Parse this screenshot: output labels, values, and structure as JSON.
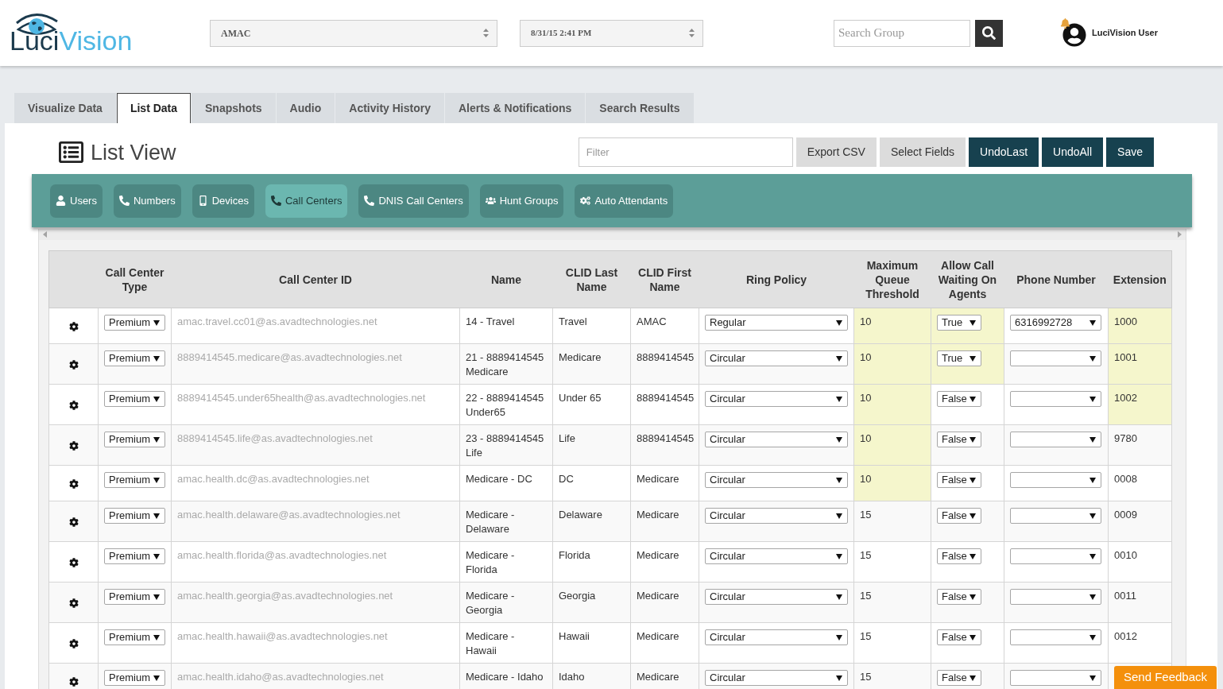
{
  "header": {
    "logo": {
      "dark_part": "Luci",
      "light_part": "Vision"
    },
    "group_select": {
      "value": "AMAC"
    },
    "date_select": {
      "value": "8/31/15 2:41 PM"
    },
    "search": {
      "placeholder": "Search Group"
    },
    "user_name": "LuciVision User"
  },
  "tabs": [
    {
      "label": "Visualize Data",
      "selected": false
    },
    {
      "label": "List Data",
      "selected": true
    },
    {
      "label": "Snapshots",
      "selected": false
    },
    {
      "label": "Audio",
      "selected": false
    },
    {
      "label": "Activity History",
      "selected": false
    },
    {
      "label": "Alerts & Notifications",
      "selected": false
    },
    {
      "label": "Search Results",
      "selected": false
    }
  ],
  "list_view": {
    "title": "List View",
    "filter": {
      "placeholder": "Filter"
    },
    "actions": [
      {
        "label": "Export CSV",
        "kind": "secondary"
      },
      {
        "label": "Select Fields",
        "kind": "secondary"
      },
      {
        "label": "UndoLast",
        "kind": "primary"
      },
      {
        "label": "UndoAll",
        "kind": "primary"
      },
      {
        "label": "Save",
        "kind": "primary"
      }
    ]
  },
  "categories": [
    {
      "label": "Users",
      "selected": false
    },
    {
      "label": "Numbers",
      "selected": false
    },
    {
      "label": "Devices",
      "selected": false
    },
    {
      "label": "Call Centers",
      "selected": true
    },
    {
      "label": "DNIS Call Centers",
      "selected": false
    },
    {
      "label": "Hunt Groups",
      "selected": false
    },
    {
      "label": "Auto Attendants",
      "selected": false
    }
  ],
  "table": {
    "columns": [
      "Call Center Type",
      "Call Center ID",
      "Name",
      "CLID Last Name",
      "CLID First Name",
      "Ring Policy",
      "Maximum Queue Threshold",
      "Allow Call Waiting On Agents",
      "Phone Number",
      "Extension"
    ],
    "rows": [
      {
        "type": "Premium",
        "call_center_id": "amac.travel.cc01@as.avadtechnologies.net",
        "name": "14 - Travel",
        "clid_last_name": "Travel",
        "clid_first_name": "AMAC",
        "ring_policy": "Regular",
        "max_queue_threshold": {
          "value": "10",
          "highlighted": true
        },
        "allow_call_waiting": {
          "value": "True",
          "highlighted": true
        },
        "phone_number": "6316992728",
        "extension": {
          "value": "1000",
          "highlighted": true
        }
      },
      {
        "type": "Premium",
        "call_center_id": "8889414545.medicare@as.avadtechnologies.net",
        "name": "21 - 8889414545 Medicare",
        "clid_last_name": "Medicare",
        "clid_first_name": "8889414545",
        "ring_policy": "Circular",
        "max_queue_threshold": {
          "value": "10",
          "highlighted": true
        },
        "allow_call_waiting": {
          "value": "True",
          "highlighted": true
        },
        "extension": {
          "value": "1001",
          "highlighted": true
        }
      },
      {
        "type": "Premium",
        "call_center_id": "8889414545.under65health@as.avadtechnologies.net",
        "name": "22 - 8889414545 Under65",
        "clid_last_name": "Under 65",
        "clid_first_name": "8889414545",
        "ring_policy": "Circular",
        "max_queue_threshold": {
          "value": "10",
          "highlighted": true
        },
        "allow_call_waiting": {
          "value": "False",
          "highlighted": false
        },
        "extension": {
          "value": "1002",
          "highlighted": true
        }
      },
      {
        "type": "Premium",
        "call_center_id": "8889414545.life@as.avadtechnologies.net",
        "name": "23 - 8889414545 Life",
        "clid_last_name": "Life",
        "clid_first_name": "8889414545",
        "ring_policy": "Circular",
        "max_queue_threshold": {
          "value": "10",
          "highlighted": true
        },
        "allow_call_waiting": {
          "value": "False",
          "highlighted": false
        },
        "extension": {
          "value": "9780",
          "highlighted": false
        }
      },
      {
        "type": "Premium",
        "call_center_id": "amac.health.dc@as.avadtechnologies.net",
        "name": "Medicare - DC",
        "clid_last_name": "DC",
        "clid_first_name": "Medicare",
        "ring_policy": "Circular",
        "max_queue_threshold": {
          "value": "10",
          "highlighted": true
        },
        "allow_call_waiting": {
          "value": "False",
          "highlighted": false
        },
        "extension": {
          "value": "0008",
          "highlighted": false
        }
      },
      {
        "type": "Premium",
        "call_center_id": "amac.health.delaware@as.avadtechnologies.net",
        "name": "Medicare - Delaware",
        "clid_last_name": "Delaware",
        "clid_first_name": "Medicare",
        "ring_policy": "Circular",
        "max_queue_threshold": {
          "value": "15",
          "highlighted": false
        },
        "allow_call_waiting": {
          "value": "False",
          "highlighted": false
        },
        "extension": {
          "value": "0009",
          "highlighted": false
        }
      },
      {
        "type": "Premium",
        "call_center_id": "amac.health.florida@as.avadtechnologies.net",
        "name": "Medicare - Florida",
        "clid_last_name": "Florida",
        "clid_first_name": "Medicare",
        "ring_policy": "Circular",
        "max_queue_threshold": {
          "value": "15",
          "highlighted": false
        },
        "allow_call_waiting": {
          "value": "False",
          "highlighted": false
        },
        "extension": {
          "value": "0010",
          "highlighted": false
        }
      },
      {
        "type": "Premium",
        "call_center_id": "amac.health.georgia@as.avadtechnologies.net",
        "name": "Medicare - Georgia",
        "clid_last_name": "Georgia",
        "clid_first_name": "Medicare",
        "ring_policy": "Circular",
        "max_queue_threshold": {
          "value": "15",
          "highlighted": false
        },
        "allow_call_waiting": {
          "value": "False",
          "highlighted": false
        },
        "extension": {
          "value": "0011",
          "highlighted": false
        }
      },
      {
        "type": "Premium",
        "call_center_id": "amac.health.hawaii@as.avadtechnologies.net",
        "name": "Medicare - Hawaii",
        "clid_last_name": "Hawaii",
        "clid_first_name": "Medicare",
        "ring_policy": "Circular",
        "max_queue_threshold": {
          "value": "15",
          "highlighted": false
        },
        "allow_call_waiting": {
          "value": "False",
          "highlighted": false
        },
        "extension": {
          "value": "0012",
          "highlighted": false
        }
      },
      {
        "type": "Premium",
        "call_center_id": "amac.health.idaho@as.avadtechnologies.net",
        "name": "Medicare - Idaho",
        "clid_last_name": "Idaho",
        "clid_first_name": "Medicare",
        "ring_policy": "Circular",
        "max_queue_threshold": {
          "value": "15",
          "highlighted": false
        },
        "allow_call_waiting": {
          "value": "False",
          "highlighted": false
        }
      }
    ]
  },
  "feedback_button": "Send Feedback"
}
